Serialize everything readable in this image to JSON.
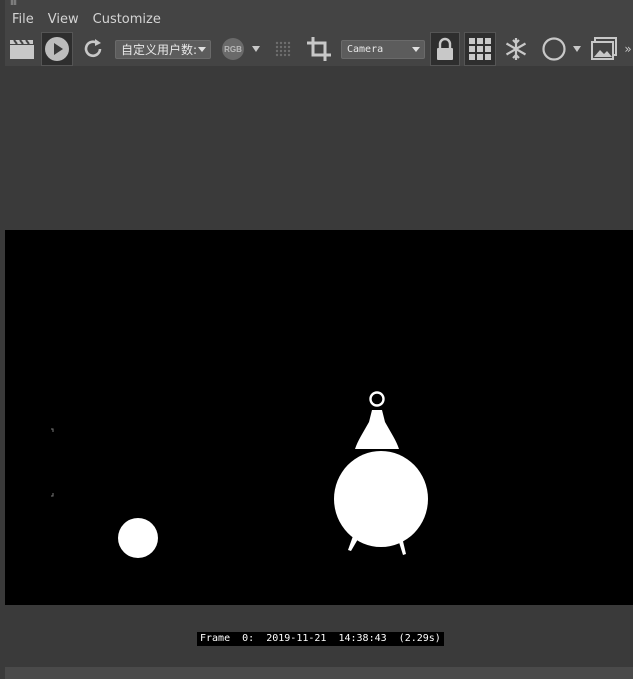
{
  "menu": [
    {
      "id": "file",
      "label": "File"
    },
    {
      "id": "view",
      "label": "View"
    },
    {
      "id": "customize",
      "label": "Customize"
    }
  ],
  "toolbar": {
    "channel_display": "自定义用户数:",
    "color_mode": "RGB",
    "view_select": "Camera",
    "icons": [
      "clapperboard-icon",
      "play-icon",
      "refresh-icon",
      "rgb-icon",
      "dot-grid-icon",
      "crop-icon",
      "lock-icon",
      "grid-icon",
      "snowflake-icon",
      "circle-icon",
      "image-icon"
    ]
  },
  "render": {
    "frame_stamp": "Frame  0:  2019-11-21  14:38:43  (2.29s)"
  },
  "colors": {
    "background": "#444444",
    "panel": "#3a3a3a",
    "render_bg": "#000000",
    "objects": "#ffffff"
  }
}
